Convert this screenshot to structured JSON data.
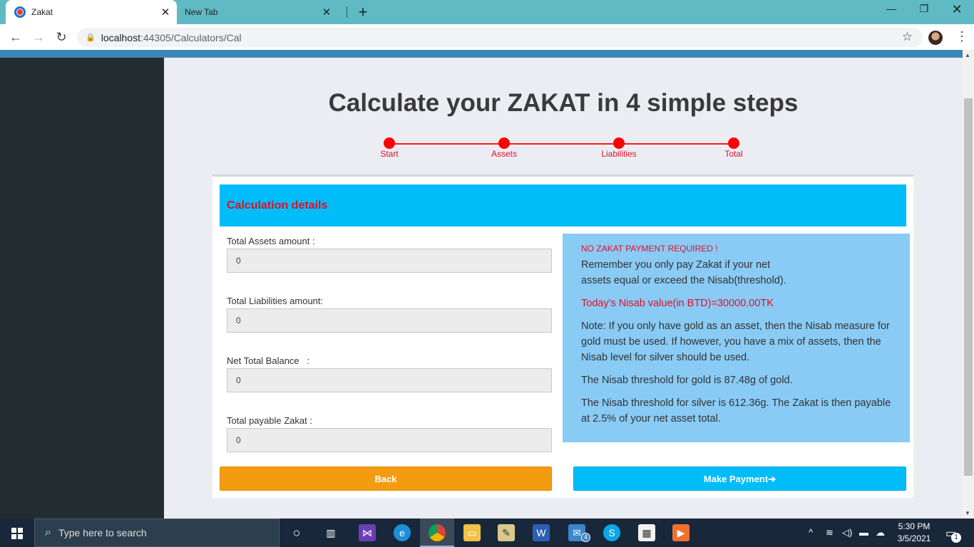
{
  "browser": {
    "tabs": [
      {
        "label": "Zakat",
        "active": true
      },
      {
        "label": "New Tab",
        "active": false
      }
    ],
    "url_host": "localhost",
    "url_path": ":44305/Calculators/Cal"
  },
  "page": {
    "title": "Calculate your ZAKAT in 4 simple steps",
    "steps": [
      "Start",
      "Assets",
      "Liabilities",
      "Total"
    ],
    "card_title": "Calculation details",
    "fields": [
      {
        "label": "Total Assets amount :",
        "value": "0"
      },
      {
        "label": "Total Liabilities amount:",
        "value": "0"
      },
      {
        "label": "Net Total Balance   :",
        "value": "0"
      },
      {
        "label": "Total payable Zakat :",
        "value": "0"
      }
    ],
    "info": {
      "warning": "NO ZAKAT PAYMENT REQUIRED !",
      "reminder": "Remember you only pay Zakat if your net assets equal or exceed the Nisab(threshold).",
      "nisab_value": "Today's Nisab value(in BTD)=30000.00TK",
      "note": "Note: If you only have gold as an asset, then the Nisab measure for gold must be used. If however, you have a mix of assets, then the Nisab level for silver should be used.",
      "gold": "The Nisab threshold for gold is 87.48g of gold.",
      "silver": "The Nisab threshold for silver is 612.36g. The Zakat is then payable at 2.5% of your net asset total."
    },
    "buttons": {
      "back": "Back",
      "pay": "Make Payment"
    }
  },
  "taskbar": {
    "search_placeholder": "Type here to search",
    "time": "5:30 PM",
    "date": "3/5/2021",
    "mail_badge": "4",
    "notification_count": "1"
  },
  "colors": {
    "accent_cyan": "#00bdf9",
    "warning_red": "#e0102a",
    "back_orange": "#f39c12",
    "info_blue": "#89cbf5",
    "sidebar_dark": "#222d32"
  }
}
